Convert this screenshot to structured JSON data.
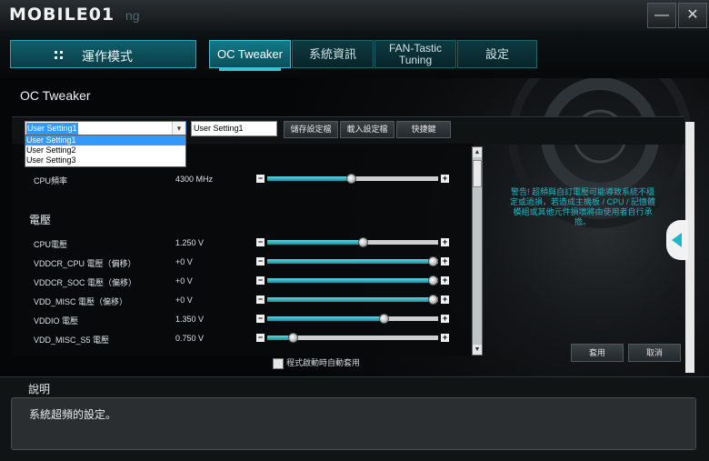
{
  "titlebar": {
    "logo_text": "MOBILE01",
    "logo_tail": "ng",
    "minimize_label": "—",
    "close_label": "✕"
  },
  "nav": {
    "mode_button": "運作模式",
    "tabs": [
      {
        "label": "OC Tweaker",
        "active": true
      },
      {
        "label": "系統資訊",
        "active": false
      },
      {
        "label": "FAN-Tastic\nTuning",
        "active": false
      },
      {
        "label": "設定",
        "active": false
      }
    ]
  },
  "panel": {
    "title": "OC Tweaker",
    "profile_select": {
      "selected": "User Setting1",
      "options": [
        "User Setting1",
        "User Setting2",
        "User Setting3"
      ]
    },
    "profile_name_input": "User Setting1",
    "save_button": "儲存設定檔",
    "load_button": "載入設定檔",
    "hotkey_button": "快捷鍵",
    "cpu_freq": {
      "name": "CPU頻率",
      "value": "4300 MHz",
      "level": 0.49
    },
    "voltage_section": "電壓",
    "voltages": [
      {
        "name": "CPU電壓",
        "value": "1.250 V",
        "level": 0.56
      },
      {
        "name": "VDDCR_CPU 電壓（偏移）",
        "value": "+0 V",
        "level": 0.97
      },
      {
        "name": "VDDCR_SOC 電壓（偏移）",
        "value": "+0 V",
        "level": 0.97
      },
      {
        "name": "VDD_MISC 電壓（偏移）",
        "value": "+0 V",
        "level": 0.97
      },
      {
        "name": "VDDIO 電壓",
        "value": "1.350 V",
        "level": 0.68
      },
      {
        "name": "VDD_MISC_S5 電壓",
        "value": "0.750 V",
        "level": 0.15
      }
    ],
    "warning": "警告! 超頻與自訂電壓可能導致系統不穩定或過損，若造成主機板 / CPU / 記憶體模組或其他元件損壞將由使用者自行承擔。",
    "apply_button": "套用",
    "cancel_button": "取消",
    "auto_apply_label": "程式啟動時自動套用"
  },
  "help": {
    "title": "說明",
    "text": "系統超頻的設定。"
  },
  "colors": {
    "accent": "#1fb7c8",
    "tab_active": "#127a88"
  }
}
